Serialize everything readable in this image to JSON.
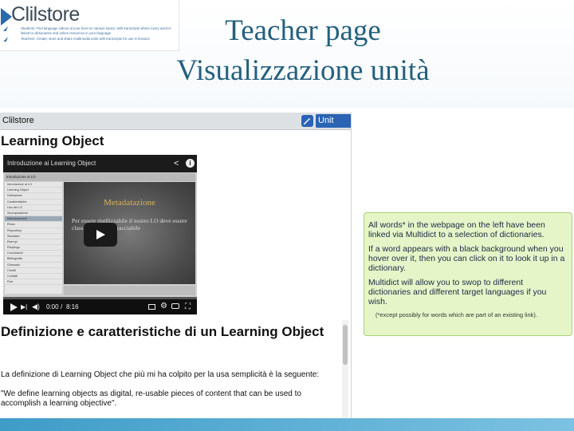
{
  "logo": {
    "brand": "Clilstore",
    "line1": "Students: Find language videos at your level on various topics, with transcripts where every word is linked to dictionaries and online resources in your language",
    "line2": "Teachers: Create, store and share multimedia units with transcripts for use in lessons"
  },
  "slide_title": {
    "line1": "Teacher page",
    "line2": "Visualizzazione unità"
  },
  "app": {
    "name": "Clilstore",
    "info_button": "Unit info",
    "unit_title": "Learning Object",
    "video": {
      "title": "Introduzione ai Learning Object",
      "toc_header": "Introduzione ai LO",
      "toc_items": [
        "Introduzione ai LO",
        "Learning Object",
        "Definizione",
        "Caratteristiche",
        "Uso dei LO",
        "Scomposizione",
        "Metadatazione",
        "Riuso",
        "Repository",
        "Standard",
        "Esempi",
        "Riepilogo",
        "Conclusioni",
        "Bibliografia",
        "Glossario",
        "Crediti",
        "Contatti",
        "Fine"
      ],
      "slide_heading": "Metadatazione",
      "slide_text": "Per essere riutilizzabile il nostro LO deve essere classificabile e rintracciabile",
      "time_current": "0:00",
      "time_separator": "/",
      "time_total": "8:16"
    },
    "heading": "Definizione e caratteristiche di un Learning Object",
    "paragraph1": "La definizione di Learning Object che più mi ha colpito per la usa semplicità è la seguente:",
    "paragraph2": "\"We define learning objects as digital, re-usable pieces of content that can be used to accomplish a learning objective\"."
  },
  "info_panel": {
    "p1": "All words* in the webpage on the left have been linked via Multidict to a selection of dictionaries.",
    "p2": "If a word appears with a black background when you hover over it, then you can click on it to look it up in a dictionary.",
    "p3": "Multidict will allow you to swop to different dictionaries and different target languages if you wish.",
    "note": "(*except possibly for words which are part of an existing link)."
  },
  "colors": {
    "title_blue": "#24607d",
    "button_blue": "#2b63b5",
    "panel_green": "#e6f5c8",
    "panel_border": "#a9d37a",
    "band_blue": "#3e9cc7"
  }
}
